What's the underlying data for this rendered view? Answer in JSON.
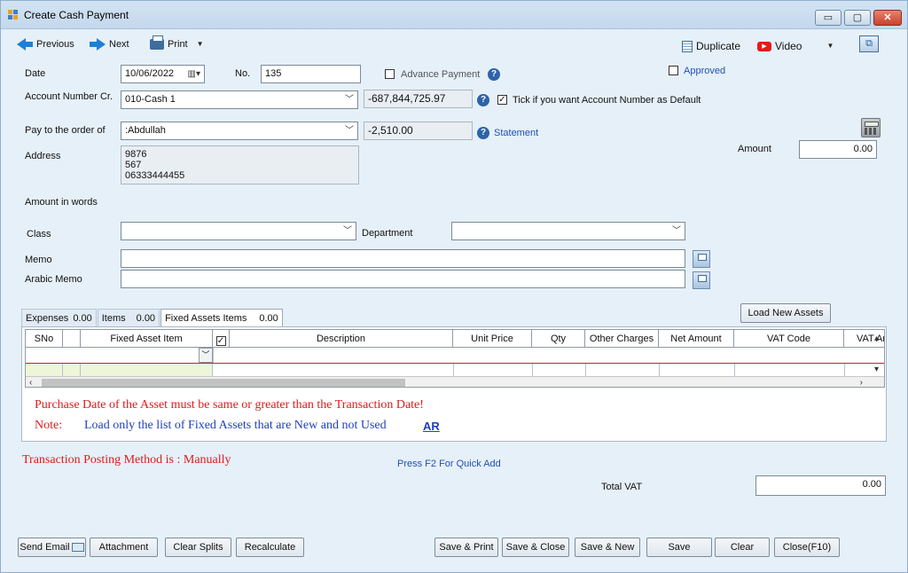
{
  "window": {
    "title": "Create Cash Payment",
    "minimize": "▭",
    "restore": "▢",
    "close": "✕"
  },
  "toolbar": {
    "previous": "Previous",
    "next": "Next",
    "print": "Print",
    "duplicate": "Duplicate",
    "video": "Video",
    "video_icon_text": "▶",
    "restore_icon": "⧉"
  },
  "form": {
    "date_label": "Date",
    "date_value": "10/06/2022",
    "no_label": "No.",
    "no_value": "135",
    "advance_payment_label": "Advance Payment",
    "approved_label": "Approved",
    "account_label": "Account Number Cr.",
    "account_value": "010-Cash 1",
    "account_balance": "-687,844,725.97",
    "default_label": "Tick if you want Account Number as Default",
    "default_checked": "✓",
    "pay_to_label": "Pay to the order of",
    "pay_to_value": ":Abdullah",
    "pay_to_balance": "-2,510.00",
    "statement_label": "Statement",
    "address_label": "Address",
    "address_lines": [
      "9876",
      "567",
      "06333444455"
    ],
    "amount_label": "Amount",
    "amount_value": "0.00",
    "amount_words_label": "Amount in words",
    "class_label": "Class",
    "class_value": "",
    "department_label": "Department",
    "department_value": "",
    "memo_label": "Memo",
    "memo_value": "",
    "arabic_memo_label": "Arabic Memo",
    "arabic_memo_value": ""
  },
  "tabs": [
    {
      "label": "Expenses",
      "count": "0.00"
    },
    {
      "label": "Items",
      "count": "0.00"
    },
    {
      "label": "Fixed Assets Items",
      "count": "0.00"
    }
  ],
  "load_new_assets": "Load New Assets",
  "grid": {
    "columns": [
      "SNo",
      "",
      "Fixed Asset Item",
      "✓",
      "Description",
      "Unit Price",
      "Qty",
      "Other Charges",
      "Net Amount",
      "VAT Code",
      "VAT An"
    ]
  },
  "notes": {
    "purchase_date": "Purchase Date of the Asset must be same or greater than the Transaction Date!",
    "note_label": "Note:",
    "note_text": "Load only the list of Fixed Assets that are New and not Used",
    "ar_link": "AR"
  },
  "posting_method": "Transaction Posting Method is : Manually",
  "quick_add": "Press F2 For Quick Add",
  "total_vat_label": "Total VAT",
  "total_vat_value": "0.00",
  "buttons": {
    "send_email": "Send Email",
    "attachment": "Attachment",
    "clear_splits": "Clear Splits",
    "recalculate": "Recalculate",
    "save_print": "Save & Print",
    "save_close": "Save & Close",
    "save_new": "Save & New",
    "save": "Save",
    "clear": "Clear",
    "close": "Close(F10)"
  }
}
